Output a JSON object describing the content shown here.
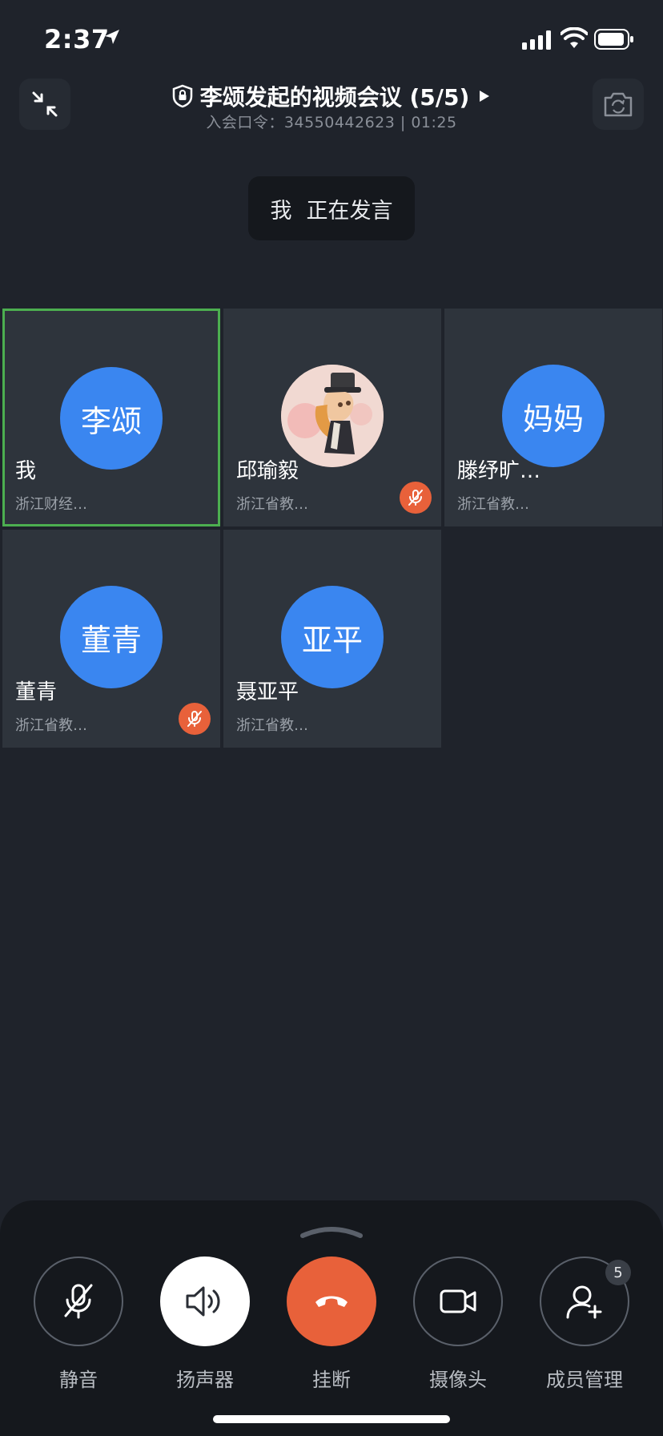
{
  "status_bar": {
    "time": "2:37"
  },
  "header": {
    "title": "李颂发起的视频会议 (5/5)",
    "subtitle": "入会口令：34550442623 | 01:25"
  },
  "speaking": {
    "who": "我",
    "text": "正在发言"
  },
  "participants": [
    {
      "avatar_text": "李颂",
      "name": "我",
      "org": "浙江财经…",
      "muted": false,
      "active": true
    },
    {
      "avatar_text": "",
      "name": "邱瑜毅",
      "org": "浙江省教…",
      "muted": true,
      "active": false
    },
    {
      "avatar_text": "妈妈",
      "name": "滕纾旷…",
      "org": "浙江省教…",
      "muted": false,
      "active": false
    },
    {
      "avatar_text": "董青",
      "name": "董青",
      "org": "浙江省教…",
      "muted": true,
      "active": false
    },
    {
      "avatar_text": "亚平",
      "name": "聂亚平",
      "org": "浙江省教…",
      "muted": false,
      "active": false
    }
  ],
  "controls": {
    "mute": "静音",
    "speaker": "扬声器",
    "hangup": "挂断",
    "camera": "摄像头",
    "members": "成员管理",
    "members_count": "5"
  },
  "colors": {
    "background": "#1f232b",
    "tile": "#2e343c",
    "avatar_blue": "#3a86f0",
    "active_border": "#4caf50",
    "mute_badge": "#e8613a",
    "hangup": "#e8613a"
  }
}
